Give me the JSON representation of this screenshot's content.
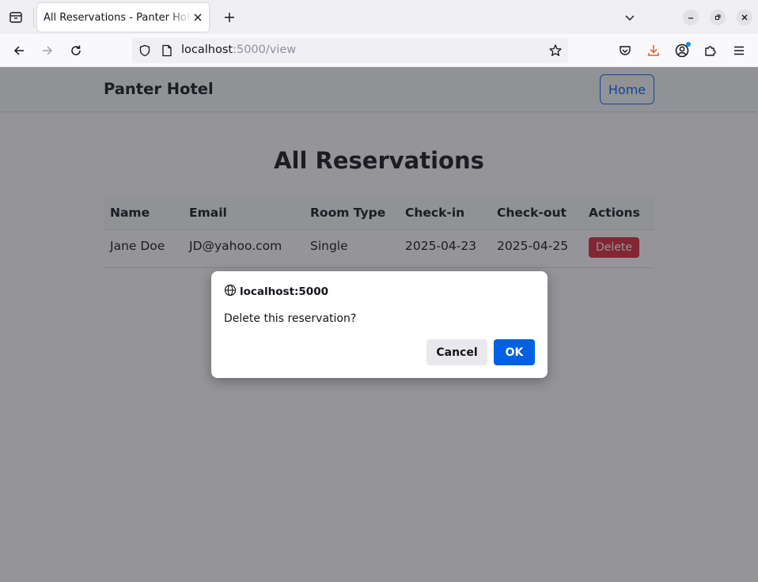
{
  "browser": {
    "tab_title": "All Reservations - Panter Hotel",
    "url_host": "localhost",
    "url_path": ":5000/view"
  },
  "site": {
    "brand": "Panter Hotel",
    "home_label": "Home"
  },
  "main": {
    "title": "All Reservations",
    "table": {
      "headers": [
        "Name",
        "Email",
        "Room Type",
        "Check-in",
        "Check-out",
        "Actions"
      ],
      "rows": [
        {
          "name": "Jane Doe",
          "email": "JD@yahoo.com",
          "room_type": "Single",
          "check_in": "2025-04-23",
          "check_out": "2025-04-25",
          "action_label": "Delete"
        }
      ]
    }
  },
  "dialog": {
    "origin": "localhost:5000",
    "message": "Delete this reservation?",
    "cancel_label": "Cancel",
    "ok_label": "OK"
  },
  "colors": {
    "primary": "#0d6efd",
    "danger": "#dc3545",
    "dialog_ok": "#0061e0",
    "download_accent": "#e25920"
  }
}
